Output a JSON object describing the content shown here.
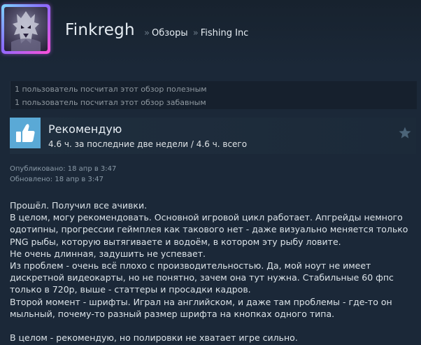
{
  "profile": {
    "username": "Finkregh",
    "avatar_icon": "dragon-avatar-icon"
  },
  "breadcrumb": {
    "separator": "»",
    "items": [
      "Обзоры",
      "Fishing Inc"
    ]
  },
  "helpful": {
    "line1": "1 пользователь посчитал этот обзор полезным",
    "line2": "1 пользователь посчитал этот обзор забавным"
  },
  "recommendation": {
    "title": "Рекомендую",
    "hours": "4.6 ч. за последние две недели / 4.6 ч. всего",
    "icon": "thumbs-up-icon",
    "award_icon": "star-icon"
  },
  "posted": {
    "published": "Опубликовано: 18 апр в 3:47",
    "updated": "Обновлено: 18 апр в 3:47"
  },
  "review": {
    "lines": [
      "Прошёл. Получил все ачивки.",
      "В целом, могу рекомендовать. Основной игровой цикл работает. Апгрейды немного одотипны, прогрессии геймплея как такового нет - даже визуально меняется только PNG рыбы, которую вытягиваете и водоём, в котором эту рыбу ловите.",
      "Не очень длинная, задушить не успевает.",
      "Из проблем - очень всё плохо с производительностью. Да, мой ноут не имеет дискретной видеокарты, но не понятно, зачем она тут нужна. Стабильные 60 фпс только в 720р, выше - статтеры и просадки кадров.",
      "Второй момент - шрифты. Играл на английском, и даже там проблемы - где-то он мыльный, почему-то разный размер шрифта на кнопках одного типа.",
      "",
      "В целом - рекомендую, но полировки не хватает игре сильно."
    ]
  },
  "colors": {
    "background": "#1b2838",
    "thumb_blue": "#5aa9d6",
    "text": "#dce3e8"
  }
}
